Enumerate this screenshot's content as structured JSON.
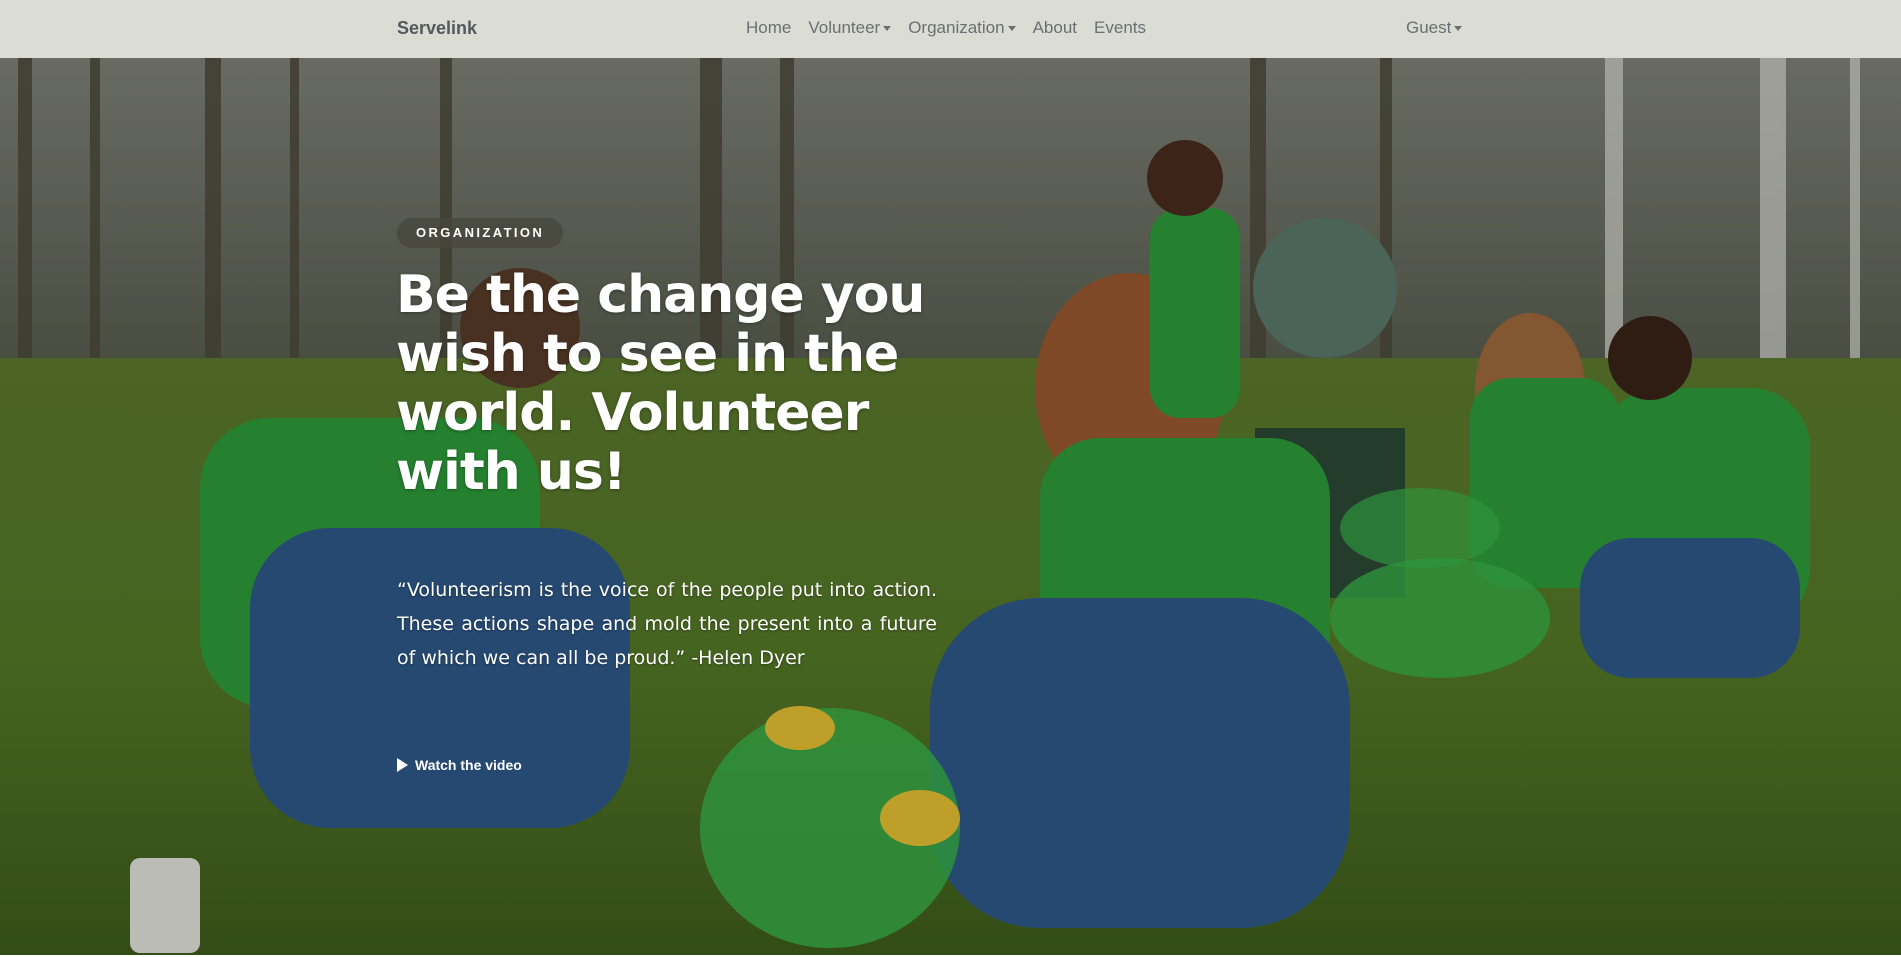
{
  "nav": {
    "brand": "Servelink",
    "links": {
      "home": "Home",
      "volunteer": "Volunteer",
      "organization": "Organization",
      "about": "About",
      "events": "Events"
    },
    "user": "Guest"
  },
  "hero": {
    "badge": "ORGANIZATION",
    "headline": "Be the change you wish to see in the world. Volunteer with us!",
    "quote": "“Volunteerism is the voice of the people put into action. These actions shape and mold the present into a future of which we can all be proud.” -Helen Dyer",
    "watch_label": "Watch the video",
    "image": "volunteers-cleaning-park-photo"
  },
  "colors": {
    "navbar_bg": "#dcdcd6",
    "nav_text": "#6c6f72",
    "shirt_green": "#2e9e3a",
    "grass_green": "#4c6e26"
  }
}
